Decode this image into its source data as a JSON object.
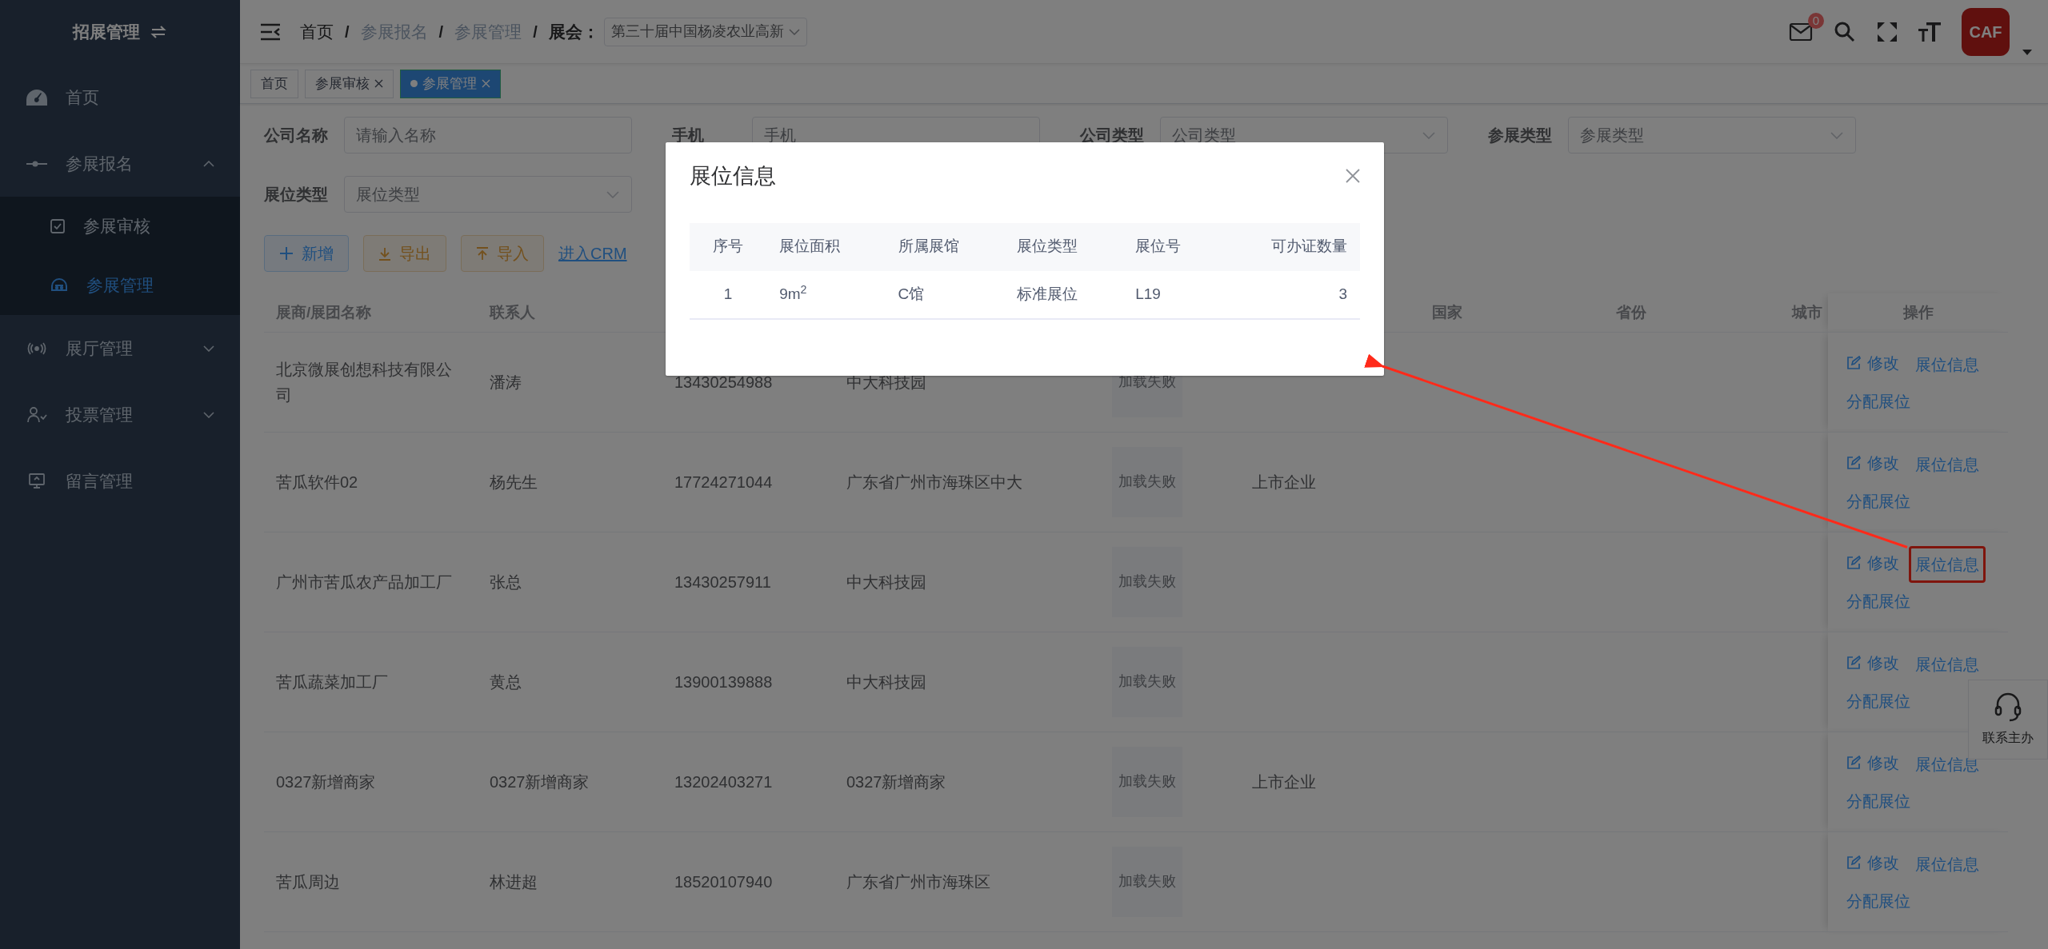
{
  "sidebar": {
    "title": "招展管理",
    "items": [
      {
        "label": "首页",
        "selected": false
      },
      {
        "label": "参展报名",
        "selected": false,
        "expanded": true,
        "children": [
          {
            "label": "参展审核",
            "selected": false
          },
          {
            "label": "参展管理",
            "selected": true
          }
        ]
      },
      {
        "label": "展厅管理",
        "selected": false,
        "expanded": false
      },
      {
        "label": "投票管理",
        "selected": false,
        "expanded": false
      },
      {
        "label": "留言管理",
        "selected": false
      }
    ]
  },
  "header": {
    "breadcrumbs": [
      {
        "label": "首页",
        "linked": true
      },
      {
        "label": "参展报名",
        "linked": false
      },
      {
        "label": "参展管理",
        "linked": false
      }
    ],
    "separator": "/",
    "exhibition": {
      "label": "展会：",
      "value": "第三十届中国杨凌农业高新"
    },
    "mail_badge": "0",
    "avatar": {
      "text": "CAF"
    }
  },
  "tags": [
    {
      "label": "首页",
      "selected": false,
      "closable": false
    },
    {
      "label": "参展审核",
      "selected": false,
      "closable": true
    },
    {
      "label": "参展管理",
      "selected": true,
      "closable": true
    }
  ],
  "filters": [
    {
      "label": "公司名称",
      "kind": "input",
      "placeholder": "请输入名称"
    },
    {
      "label": "手机",
      "kind": "input",
      "placeholder": "手机"
    },
    {
      "label": "公司类型",
      "kind": "select",
      "placeholder": "公司类型"
    },
    {
      "label": "参展类型",
      "kind": "select",
      "placeholder": "参展类型"
    },
    {
      "label": "展位类型",
      "kind": "select",
      "placeholder": "展位类型"
    }
  ],
  "buttons": [
    {
      "label": "新增",
      "kind": "add"
    },
    {
      "label": "导出",
      "kind": "export"
    },
    {
      "label": "导入",
      "kind": "import"
    }
  ],
  "crm_link": "进入CRM",
  "table": {
    "columns": {
      "company_name": "展商/展团名称",
      "contact": "联系人",
      "country": "国家",
      "province": "省份",
      "city": "城市",
      "actions": "操作"
    },
    "rows": [
      {
        "company_name": "北京微展创想科技有限公司",
        "contact": "潘涛",
        "phone": "13430254988",
        "address": "中大科技园",
        "logo": "加载失败",
        "actions": [
          "修改",
          "展位信息",
          "分配展位"
        ],
        "highlighted": false
      },
      {
        "company_name": "苦瓜软件02",
        "contact": "杨先生",
        "phone": "17724271044",
        "address": "广东省广州市海珠区中大",
        "logo": "加载失败",
        "company_type": "上市企业",
        "actions": [
          "修改",
          "展位信息",
          "分配展位"
        ],
        "highlighted": false
      },
      {
        "company_name": "广州市苦瓜农产品加工厂",
        "contact": "张总",
        "phone": "13430257911",
        "address": "中大科技园",
        "logo": "加载失败",
        "actions": [
          "修改",
          "展位信息",
          "分配展位"
        ],
        "highlighted": true
      },
      {
        "company_name": "苦瓜蔬菜加工厂",
        "contact": "黄总",
        "phone": "13900139888",
        "address": "中大科技园",
        "logo": "加载失败",
        "actions": [
          "修改",
          "展位信息",
          "分配展位"
        ],
        "highlighted": false
      },
      {
        "company_name": "0327新增商家",
        "contact": "0327新增商家",
        "phone": "13202403271",
        "address": "0327新增商家",
        "logo": "加载失败",
        "company_type": "上市企业",
        "actions": [
          "修改",
          "展位信息",
          "分配展位"
        ],
        "highlighted": false
      },
      {
        "company_name": "苦瓜周边",
        "contact": "林进超",
        "phone": "18520107940",
        "address": "广东省广州市海珠区",
        "logo": "加载失败",
        "actions": [
          "修改",
          "展位信息",
          "分配展位"
        ],
        "highlighted": false
      }
    ]
  },
  "contact_widget": {
    "label": "联系主办"
  },
  "modal": {
    "title": "展位信息",
    "columns": [
      "序号",
      "展位面积",
      "所属展馆",
      "展位类型",
      "展位号",
      "可办证数量"
    ],
    "rows": [
      [
        "1",
        "9m$^{2}$",
        "C馆",
        "标准展位",
        "L19",
        "3"
      ]
    ]
  }
}
